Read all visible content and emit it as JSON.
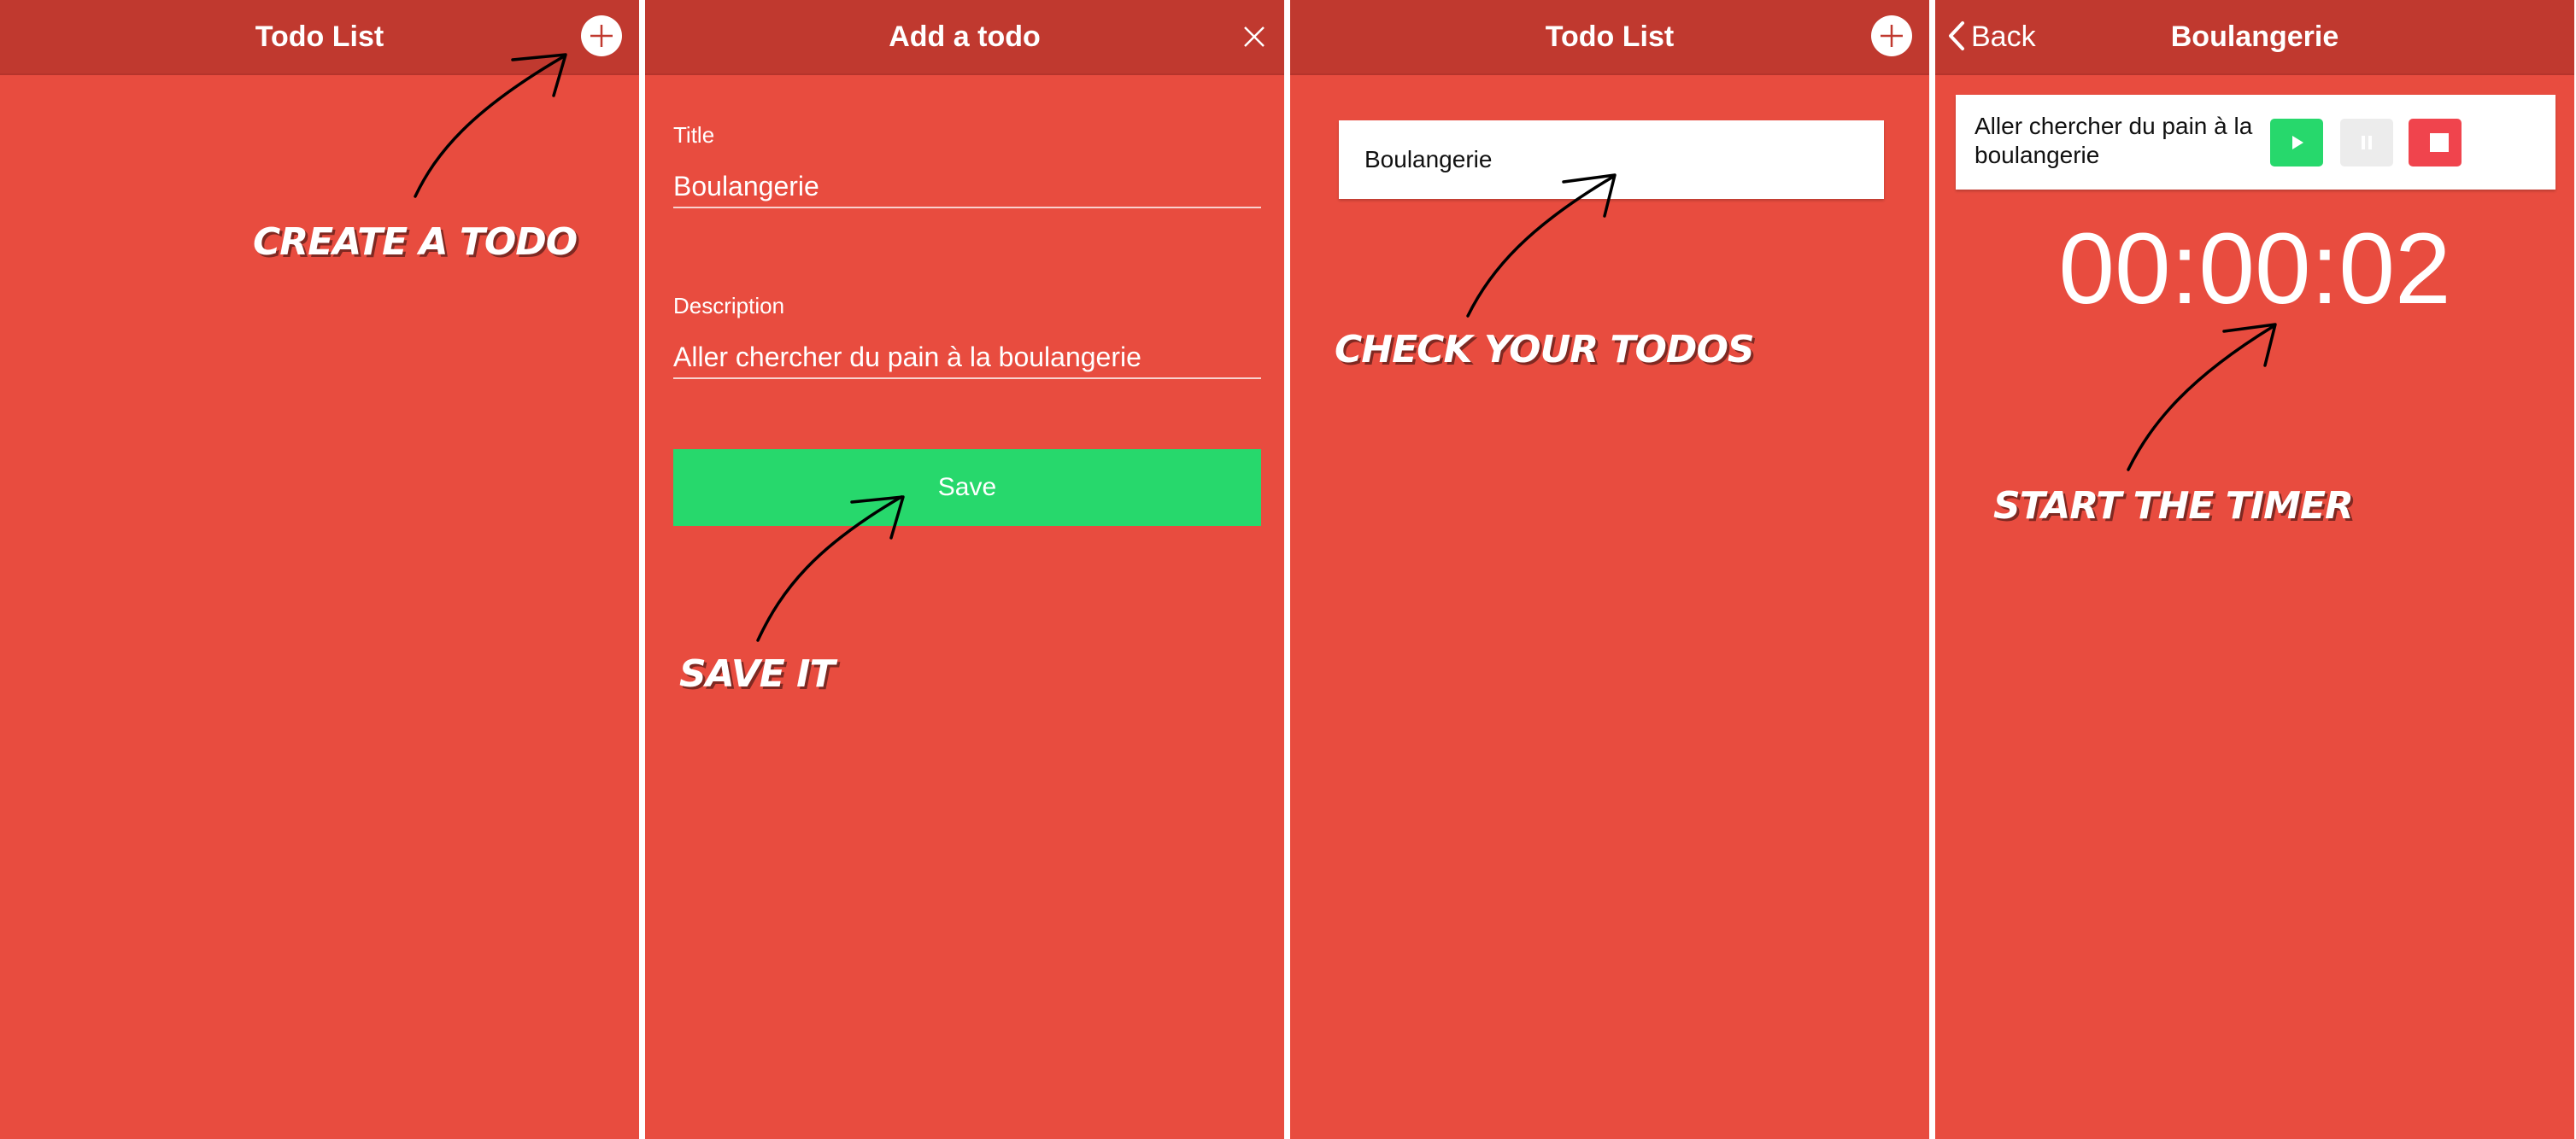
{
  "screens": [
    {
      "title": "Todo List",
      "annotation": "CREATE A TODO"
    },
    {
      "title": "Add a todo",
      "form": {
        "title_label": "Title",
        "title_value": "Boulangerie",
        "description_label": "Description",
        "description_value": "Aller chercher du pain à la boulangerie",
        "save_label": "Save"
      },
      "annotation": "SAVE IT"
    },
    {
      "title": "Todo List",
      "items": [
        "Boulangerie"
      ],
      "annotation": "CHECK YOUR TODOS"
    },
    {
      "back_label": "Back",
      "title": "Boulangerie",
      "description": "Aller chercher du pain à la boulangerie",
      "timer": "00:00:02",
      "annotation": "START THE TIMER"
    }
  ],
  "icons": {
    "add": "plus-circle-icon",
    "close": "close-icon",
    "back": "chevron-left-icon",
    "play": "play-icon",
    "pause": "pause-icon",
    "stop": "stop-icon",
    "annotation_arrow": "hand-drawn-arrow-icon"
  },
  "colors": {
    "background": "#e84c3f",
    "navbar": "#c0392f",
    "save_button": "#27d86c",
    "play_button": "#27d86c",
    "pause_button": "#ececec",
    "stop_button": "#f0444d",
    "divider": "#ffffff"
  }
}
